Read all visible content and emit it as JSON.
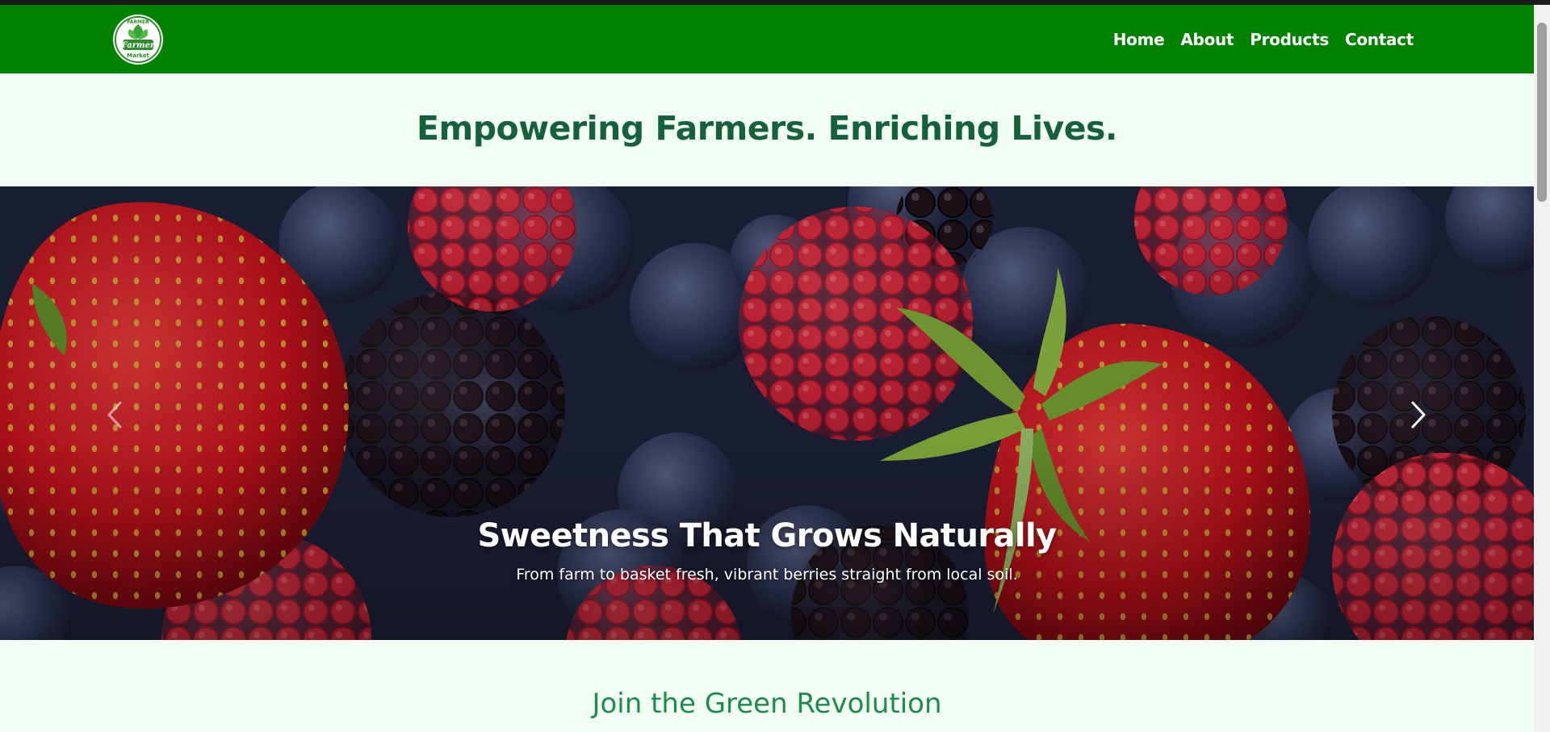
{
  "navbar": {
    "logo_alt": "Farmer Market logo",
    "logo_text_top": "FARMER",
    "logo_text_main": "Farmer",
    "logo_text_bottom": "Market",
    "links": [
      {
        "label": "Home"
      },
      {
        "label": "About"
      },
      {
        "label": "Products"
      },
      {
        "label": "Contact"
      }
    ],
    "background_color": "#008100"
  },
  "hero": {
    "headline": "Empowering Farmers. Enriching Lives."
  },
  "carousel": {
    "slide_title": "Sweetness That Grows Naturally",
    "slide_text": "From farm to basket fresh, vibrant berries straight from local soil.",
    "prev_icon": "chevron-left-icon",
    "next_icon": "chevron-right-icon"
  },
  "section": {
    "title": "Join the Green Revolution"
  },
  "colors": {
    "page_background": "#f2fff5",
    "headline": "#16603b",
    "section_title": "#1f8a4c"
  }
}
